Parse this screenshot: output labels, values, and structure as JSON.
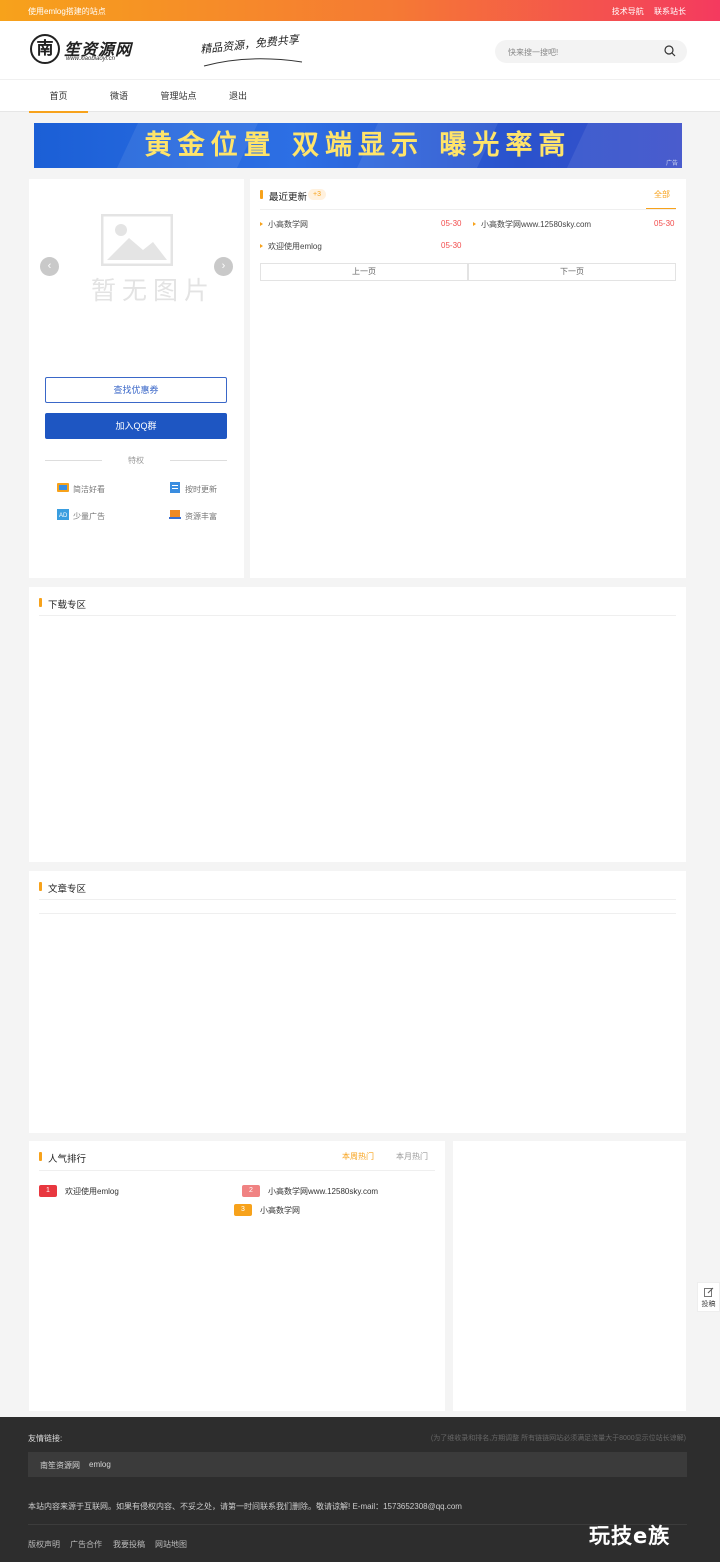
{
  "topbar": {
    "left_text": "使用emlog搭建的站点",
    "links": [
      "技术导航",
      "联系站长"
    ]
  },
  "header": {
    "logo_char": "南",
    "logo_name": "笙资源网",
    "logo_domain": "www.xiaobiaoyl.cn",
    "slogan": "精品资源，免费共享",
    "search_placeholder": "快来搜一搜吧!"
  },
  "nav": [
    "首页",
    "微语",
    "管理站点",
    "退出"
  ],
  "banner": {
    "text": "黄金位置 双端显示 曝光率高",
    "ad_label": "广告"
  },
  "slider": {
    "no_image_text": "暂无图片",
    "prev": "‹",
    "next": "›"
  },
  "side": {
    "coupon_button": "查找优惠券",
    "qq_button": "加入QQ群",
    "privileges_label": "特权",
    "perks": [
      "简洁好看",
      "按时更新",
      "少量广告",
      "资源丰富"
    ]
  },
  "recent": {
    "title": "最近更新",
    "badge": "+3",
    "all_link": "全部",
    "items": [
      {
        "title": "小高数学网",
        "date": "05-30"
      },
      {
        "title": "小高数学网www.12580sky.com",
        "date": "05-30"
      },
      {
        "title": "欢迎使用emlog",
        "date": "05-30"
      }
    ],
    "prev_page": "上一页",
    "next_page": "下一页"
  },
  "download_section": {
    "title": "下载专区"
  },
  "article_section": {
    "title": "文章专区"
  },
  "ranking": {
    "title": "人气排行",
    "tabs": [
      "本周热门",
      "本月热门"
    ],
    "items": [
      {
        "rank": "1",
        "title": "欢迎使用emlog",
        "color": "#e8373f"
      },
      {
        "rank": "2",
        "title": "小高数学网www.12580sky.com",
        "color": "#f08282"
      },
      {
        "rank": "3",
        "title": "小高数学网",
        "color": "#f7a21b"
      }
    ]
  },
  "float_button": "投稿",
  "footer": {
    "links_label": "友情链接:",
    "links_note": "(为了维收录和排名,方期调整 所有链链网站必须满足流量大于8000显示位站长谅解)",
    "links": [
      "南笙资源网",
      "emlog"
    ],
    "copyright": "本站内容来源于互联网。如果有侵权内容、不妥之处，请第一时间联系我们删除。敬请谅解! E-mail：1573652308@qq.com",
    "menu": [
      "版权声明",
      "广告合作",
      "我要投稿",
      "网站地图"
    ]
  },
  "watermark": "玩技e族",
  "colors": {
    "accent": "#f7a21b",
    "primary_blue": "#1e56c2",
    "date_red": "#f24d4d"
  }
}
